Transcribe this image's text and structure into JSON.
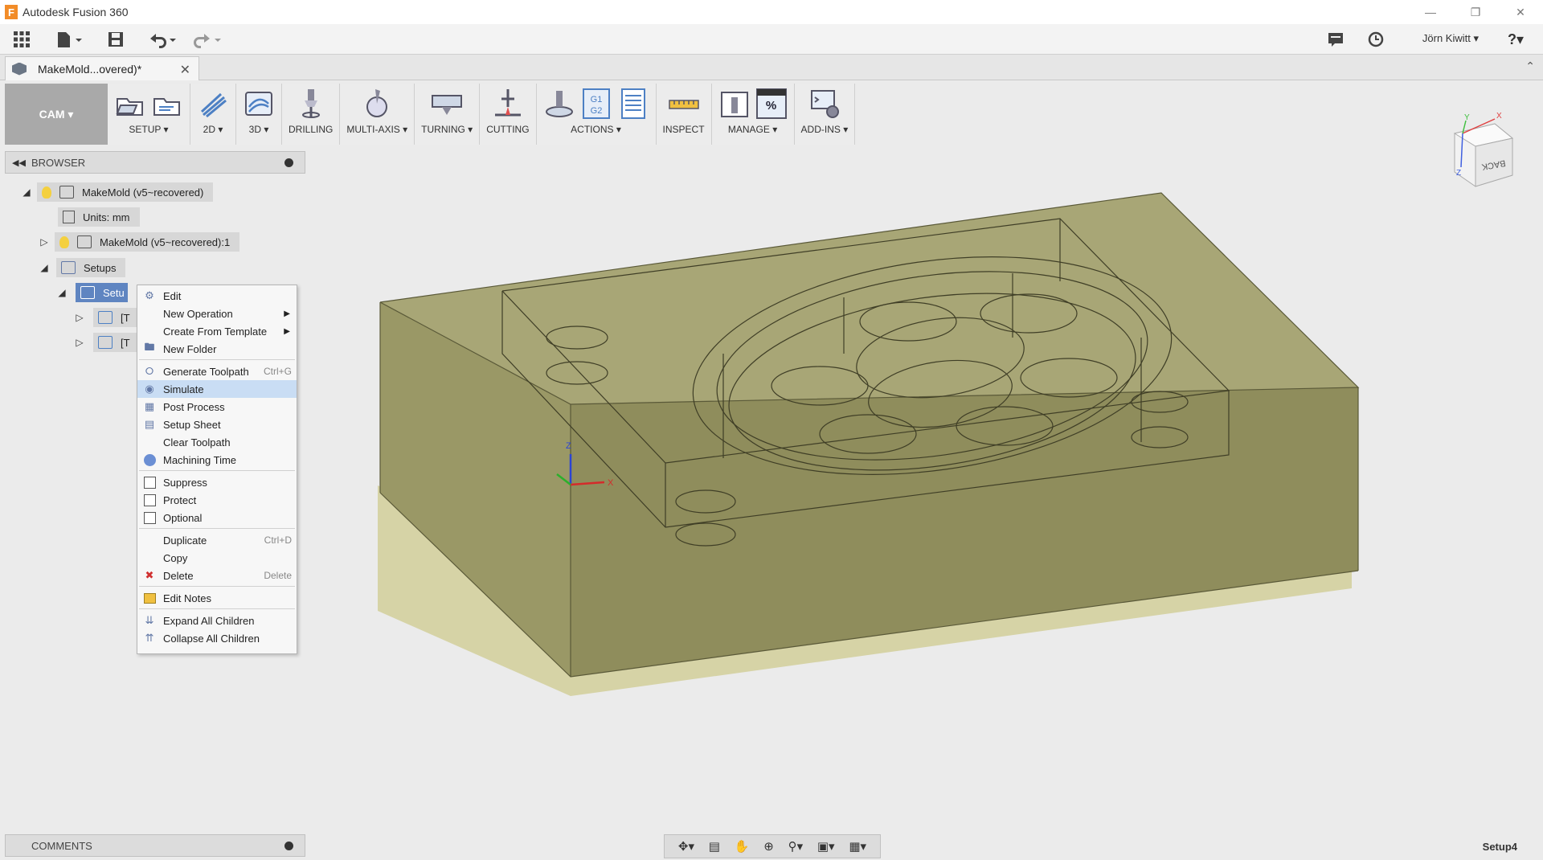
{
  "window": {
    "title": "Autodesk Fusion 360",
    "logo": "F"
  },
  "qab": {
    "user": "Jörn Kiwitt ▾",
    "help": "?▾"
  },
  "tab": {
    "name": "MakeMold...overed)*",
    "close": "✕"
  },
  "toolbar": {
    "workspace": "CAM ▾",
    "groups": {
      "setup": "SETUP ▾",
      "g2d": "2D ▾",
      "g3d": "3D ▾",
      "drilling": "DRILLING",
      "multiaxis": "MULTI-AXIS ▾",
      "turning": "TURNING ▾",
      "cutting": "CUTTING",
      "actions": "ACTIONS ▾",
      "inspect": "INSPECT",
      "manage": "MANAGE ▾",
      "addins": "ADD-INS ▾"
    },
    "g1g2": "G1 G2",
    "percent": "%"
  },
  "browser": {
    "title": "BROWSER",
    "root": "MakeMold (v5~recovered)",
    "units": "Units: mm",
    "component": "MakeMold (v5~recovered):1",
    "setups": "Setups",
    "setup": "Setu",
    "op1": "[T",
    "op2": "[T"
  },
  "context_menu": {
    "edit": "Edit",
    "new_operation": "New Operation",
    "create_from_template": "Create From Template",
    "new_folder": "New Folder",
    "generate_toolpath": "Generate Toolpath",
    "generate_shortcut": "Ctrl+G",
    "simulate": "Simulate",
    "post_process": "Post Process",
    "setup_sheet": "Setup Sheet",
    "clear_toolpath": "Clear Toolpath",
    "machining_time": "Machining Time",
    "suppress": "Suppress",
    "protect": "Protect",
    "optional": "Optional",
    "duplicate": "Duplicate",
    "duplicate_shortcut": "Ctrl+D",
    "copy": "Copy",
    "delete": "Delete",
    "delete_shortcut": "Delete",
    "edit_notes": "Edit Notes",
    "expand_all": "Expand All Children",
    "collapse_all": "Collapse All Children"
  },
  "viewcube": {
    "face": "BACK"
  },
  "axes": {
    "x": "X",
    "y": "Y",
    "z": "Z"
  },
  "comments": {
    "title": "COMMENTS"
  },
  "status": {
    "active": "Setup4"
  },
  "colors": {
    "stock": "#9f9d6a",
    "selection": "#5f85c1",
    "highlight": "#c9ddf4"
  }
}
